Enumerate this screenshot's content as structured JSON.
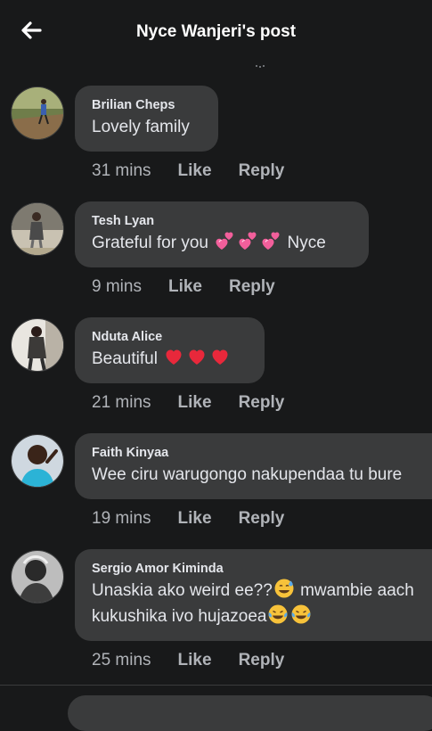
{
  "header": {
    "title": "Nyce Wanjeri's post",
    "back_icon": "arrow-left-icon"
  },
  "comments": [
    {
      "author": "Brilian Cheps",
      "text": "Lovely family",
      "time": "31 mins",
      "like": "Like",
      "reply": "Reply"
    },
    {
      "author": "Tesh Lyan",
      "text_before": "Grateful for you",
      "text_after": "Nyce",
      "emoji": "revolving-hearts-icon",
      "time": "9 mins",
      "like": "Like",
      "reply": "Reply"
    },
    {
      "author": "Nduta Alice",
      "text": "Beautiful",
      "emoji": "red-heart-icon",
      "time": "21 mins",
      "like": "Like",
      "reply": "Reply"
    },
    {
      "author": "Faith Kinyaa",
      "text": "Wee ciru warugongo nakupendaa tu bure",
      "time": "19 mins",
      "like": "Like",
      "reply": "Reply"
    },
    {
      "author": "Sergio Amor Kiminda",
      "line1": "Unaskia ako weird ee??",
      "line1_after": "mwambie aach",
      "line2": "kukushika ivo hujazoea",
      "emoji_sweat": "grinning-sweat-icon",
      "emoji_tears": "tears-of-joy-icon",
      "time": "25 mins",
      "like": "Like",
      "reply": "Reply"
    }
  ],
  "colors": {
    "background": "#18191a",
    "bubble": "#3a3b3c",
    "text": "#e4e6eb",
    "meta": "#b0b3b8",
    "heart": "#e8283b",
    "pink_heart": "#f25f9b"
  }
}
